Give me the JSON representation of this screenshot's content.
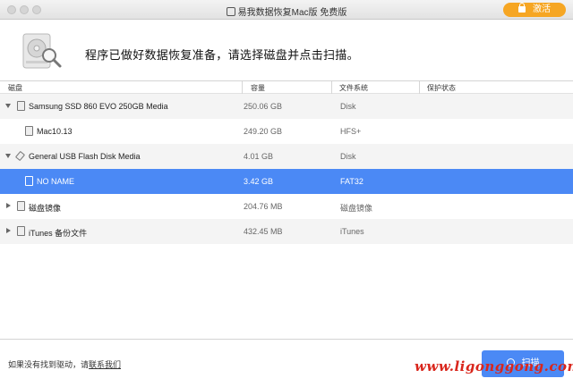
{
  "window": {
    "title": "易我数据恢复Mac版 免费版",
    "activate_label": "激活"
  },
  "header": {
    "prompt": "程序已做好数据恢复准备，请选择磁盘并点击扫描。"
  },
  "table": {
    "columns": [
      "磁盘",
      "容量",
      "文件系统",
      "保护状态"
    ],
    "rows": [
      {
        "name": "Samsung SSD 860 EVO 250GB Media",
        "capacity": "250.06 GB",
        "fs": "Disk",
        "protection": "",
        "expander": "expanded",
        "icon": "internal-disk-icon"
      },
      {
        "name": "Mac10.13",
        "capacity": "249.20 GB",
        "fs": "HFS+",
        "protection": "",
        "expander": "none",
        "icon": "volume-icon"
      },
      {
        "name": "General USB Flash Disk Media",
        "capacity": "4.01 GB",
        "fs": "Disk",
        "protection": "",
        "expander": "expanded",
        "icon": "usb-drive-icon"
      },
      {
        "name": "NO NAME",
        "capacity": "3.42 GB",
        "fs": "FAT32",
        "protection": "",
        "expander": "none",
        "icon": "volume-icon",
        "selected": true
      },
      {
        "name": "磁盘镜像",
        "capacity": "204.76 MB",
        "fs": "磁盘镜像",
        "protection": "",
        "expander": "collapsed",
        "icon": "disk-image-icon"
      },
      {
        "name": "iTunes 备份文件",
        "capacity": "432.45 MB",
        "fs": "iTunes",
        "protection": "",
        "expander": "collapsed",
        "icon": "itunes-backup-icon"
      }
    ]
  },
  "footer": {
    "help_text": "如果没有找到驱动，请",
    "contact_label": "联系我们",
    "scan_label": "扫描",
    "watermark": "www.ligonggong.com"
  },
  "colors": {
    "accent": "#4b89f5",
    "activate": "#f6a623",
    "watermark": "#d9261c"
  }
}
